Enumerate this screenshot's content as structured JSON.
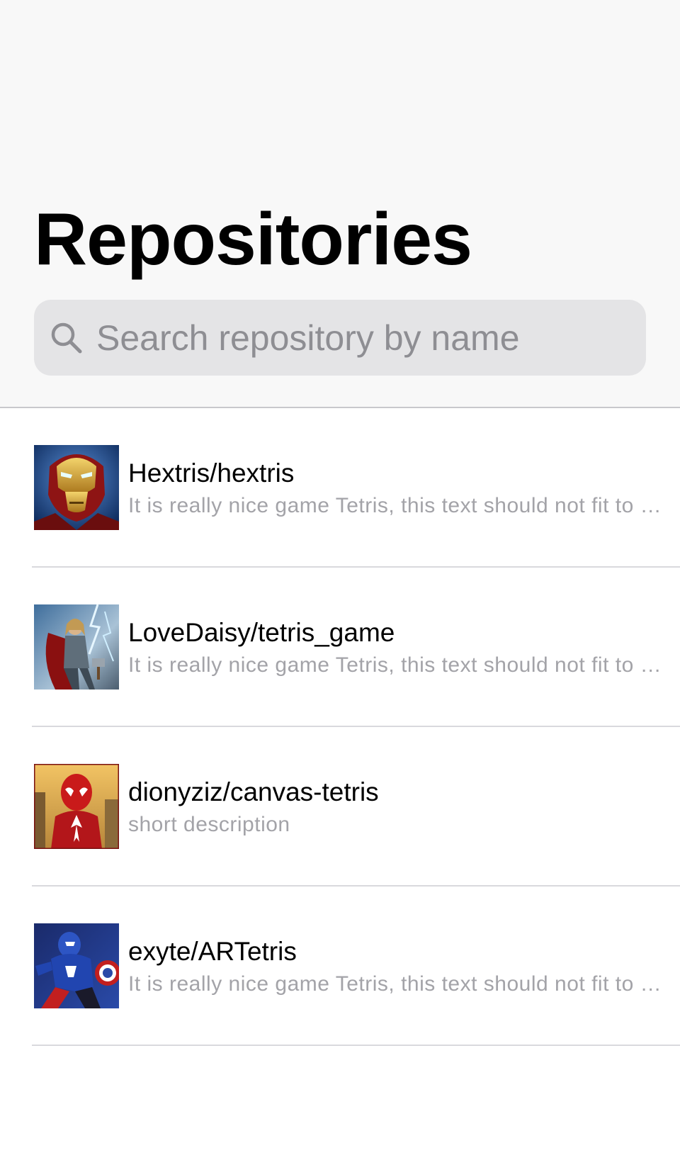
{
  "header": {
    "title": "Repositories"
  },
  "search": {
    "placeholder": "Search repository by name",
    "value": ""
  },
  "repositories": [
    {
      "name": "Hextris/hextris",
      "description": "It is really nice game Tetris, this text should not fit to one line",
      "avatar": "iron-man-avatar"
    },
    {
      "name": "LoveDaisy/tetris_game",
      "description": "It is really nice game Tetris, this text should not fit to one line",
      "avatar": "thor-avatar"
    },
    {
      "name": "dionyziz/canvas-tetris",
      "description": "short description",
      "avatar": "spider-man-avatar"
    },
    {
      "name": "exyte/ARTetris",
      "description": "It is really nice game Tetris, this text should not fit to one line",
      "avatar": "captain-america-avatar"
    }
  ],
  "colors": {
    "header_bg": "#f8f8f8",
    "search_bg": "#e4e4e6",
    "placeholder": "#8e8e93",
    "description": "#a3a3a8",
    "divider": "#d9d9dd"
  }
}
